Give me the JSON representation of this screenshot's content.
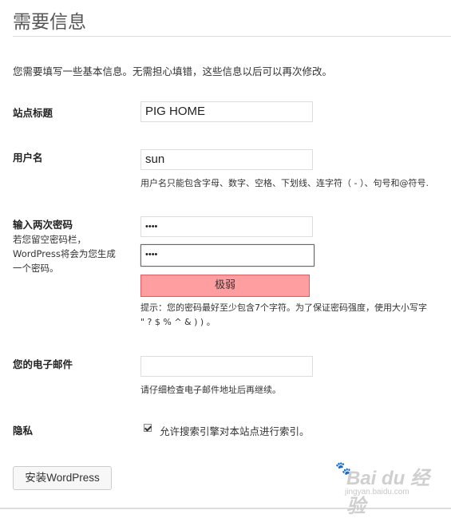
{
  "page": {
    "title": "需要信息",
    "intro": "您需要填写一些基本信息。无需担心填错，这些信息以后可以再次修改。"
  },
  "fields": {
    "site_title": {
      "label": "站点标题",
      "value": "PIG HOME"
    },
    "username": {
      "label": "用户名",
      "value": "sun",
      "hint": "用户名只能包含字母、数字、空格、下划线、连字符（ - ）、句号和@符号."
    },
    "password": {
      "label": "输入两次密码",
      "sublabel_line1": "若您留空密码栏，",
      "sublabel_line2": "WordPress将会为您生成",
      "sublabel_line3": "一个密码。",
      "value1": "••••",
      "value2": "••••",
      "strength": "极弱",
      "hint_line1": "提示：您的密码最好至少包含7个字符。为了保证密码强度，使用大小写字",
      "hint_line2": "\" ? $ % ^ & ) ) 。"
    },
    "email": {
      "label": "您的电子邮件",
      "value": "",
      "hint": "请仔细检查电子邮件地址后再继续。"
    },
    "privacy": {
      "label": "隐私",
      "checkbox_label": "允许搜索引擎对本站点进行索引。",
      "checked": true
    }
  },
  "actions": {
    "install_label": "安装WordPress"
  },
  "watermark": {
    "main": "Bai du 经验",
    "sub": "jingyan.baidu.com"
  },
  "colors": {
    "strength_bg": "#ff9ea0",
    "strength_border": "#e35b5f"
  }
}
